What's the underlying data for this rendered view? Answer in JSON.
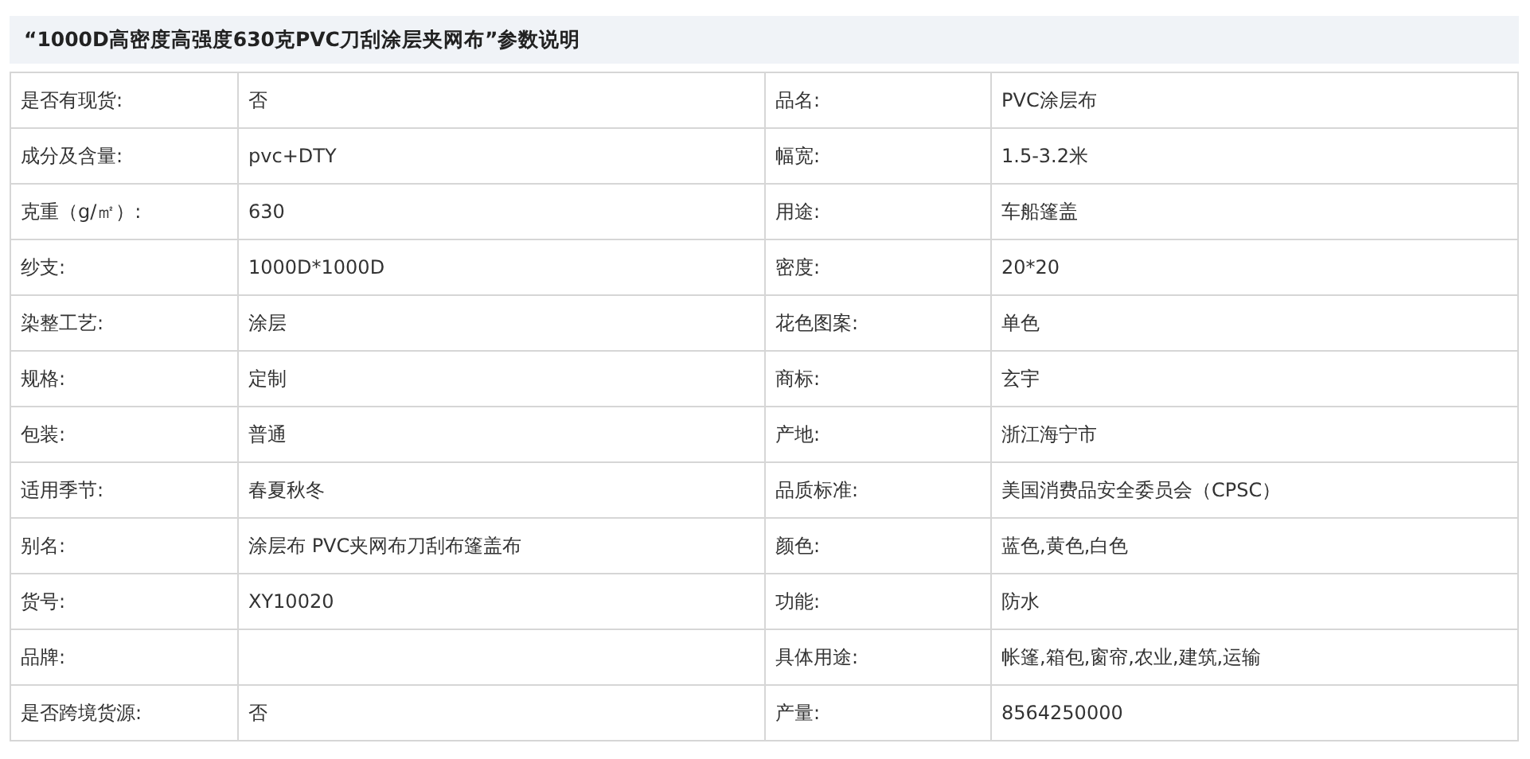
{
  "title": "“1000D高密度高强度630克PVC刀刮涂层夹网布”参数说明",
  "rows": [
    {
      "left": {
        "label": "是否有现货:",
        "value": "否"
      },
      "right": {
        "label": "品名:",
        "value": "PVC涂层布"
      }
    },
    {
      "left": {
        "label": "成分及含量:",
        "value": "pvc+DTY"
      },
      "right": {
        "label": "幅宽:",
        "value": "1.5-3.2米"
      }
    },
    {
      "left": {
        "label": "克重（g/㎡）:",
        "value": "630"
      },
      "right": {
        "label": "用途:",
        "value": "车船篷盖"
      }
    },
    {
      "left": {
        "label": "纱支:",
        "value": "1000D*1000D"
      },
      "right": {
        "label": "密度:",
        "value": "20*20"
      }
    },
    {
      "left": {
        "label": "染整工艺:",
        "value": "涂层"
      },
      "right": {
        "label": "花色图案:",
        "value": "单色"
      }
    },
    {
      "left": {
        "label": "规格:",
        "value": "定制"
      },
      "right": {
        "label": "商标:",
        "value": "玄宇"
      }
    },
    {
      "left": {
        "label": "包装:",
        "value": "普通"
      },
      "right": {
        "label": "产地:",
        "value": "浙江海宁市"
      }
    },
    {
      "left": {
        "label": "适用季节:",
        "value": "春夏秋冬"
      },
      "right": {
        "label": "品质标准:",
        "value": "美国消费品安全委员会（CPSC）"
      }
    },
    {
      "left": {
        "label": "别名:",
        "value": "涂层布 PVC夹网布刀刮布篷盖布"
      },
      "right": {
        "label": "颜色:",
        "value": "蓝色,黄色,白色"
      }
    },
    {
      "left": {
        "label": "货号:",
        "value": "XY10020"
      },
      "right": {
        "label": "功能:",
        "value": "防水"
      }
    },
    {
      "left": {
        "label": "品牌:"
      },
      "right": {
        "label": "具体用途:",
        "value": "帐篷,箱包,窗帘,农业,建筑,运输"
      }
    },
    {
      "left": {
        "label": "是否跨境货源:",
        "value": "否"
      },
      "right": {
        "label": "产量:",
        "value": "8564250000"
      }
    }
  ]
}
